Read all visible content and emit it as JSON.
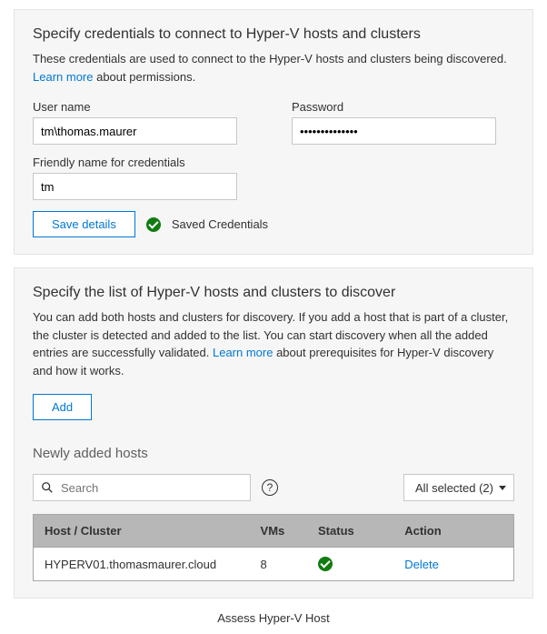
{
  "credentials": {
    "title": "Specify credentials to connect to Hyper-V hosts and clusters",
    "desc_pre": "These credentials are used to connect to the Hyper-V hosts and clusters being discovered. ",
    "learn_more": "Learn more",
    "desc_post": " about permissions.",
    "username_label": "User name",
    "username_value": "tm\\thomas.maurer",
    "password_label": "Password",
    "password_value": "••••••••••••••",
    "friendly_label": "Friendly name for credentials",
    "friendly_value": "tm",
    "save_btn": "Save details",
    "saved_status": "Saved Credentials"
  },
  "hosts": {
    "title": "Specify the list of Hyper-V hosts and clusters to discover",
    "desc_pre": "You can add both hosts and clusters for discovery. If you add a host that is part of a cluster, the cluster is detected and added to the list. You can start discovery when all the added entries are successfully validated. ",
    "learn_more": "Learn more",
    "desc_post": " about prerequisites for Hyper-V discovery and how it works.",
    "add_btn": "Add",
    "newly_added": "Newly added hosts",
    "search_placeholder": "Search",
    "filter_label": "All selected (2)",
    "table": {
      "col_host": "Host / Cluster",
      "col_vms": "VMs",
      "col_status": "Status",
      "col_action": "Action",
      "rows": [
        {
          "host": "HYPERV01.thomasmaurer.cloud",
          "vms": "8",
          "action": "Delete"
        }
      ]
    }
  },
  "caption": "Assess Hyper-V Host"
}
